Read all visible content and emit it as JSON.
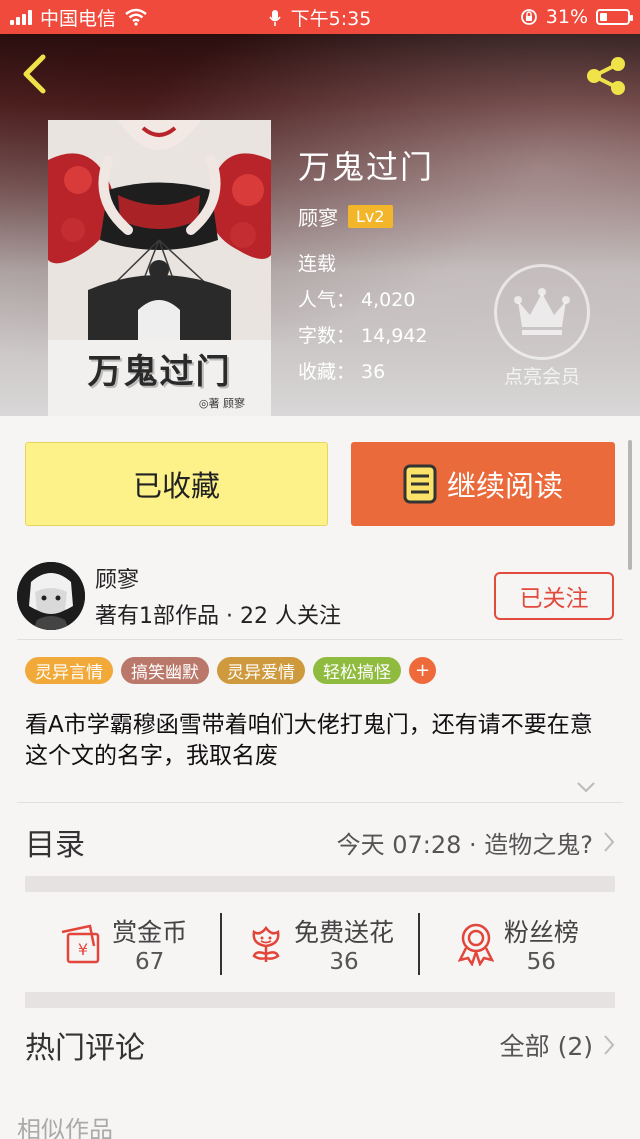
{
  "statusbar": {
    "carrier": "中国电信",
    "time": "下午5:35",
    "battery": "31%",
    "battery_level": 0.31
  },
  "book": {
    "title": "万鬼过门",
    "cover_title": "万鬼过门",
    "cover_author": "◎著 顾寥",
    "author": "顾寥",
    "level": "Lv2",
    "status": "连载",
    "stats": [
      {
        "label": "人气：",
        "value": "4,020"
      },
      {
        "label": "字数：",
        "value": "14,942"
      },
      {
        "label": "收藏：",
        "value": "36"
      }
    ],
    "vip_label": "点亮会员"
  },
  "actions": {
    "favorite_label": "已收藏",
    "read_label": "继续阅读"
  },
  "author_block": {
    "name": "顾寥",
    "meta": "著有1部作品 · 22 人关注",
    "follow_label": "已关注"
  },
  "tags": [
    {
      "label": "灵异言情",
      "color": "#f1a93a"
    },
    {
      "label": "搞笑幽默",
      "color": "#b9786a"
    },
    {
      "label": "灵异爱情",
      "color": "#cf9a3e"
    },
    {
      "label": "轻松搞怪",
      "color": "#8fbb3f"
    }
  ],
  "tag_more": "+",
  "description": "看A市学霸穆函雪带着咱们大佬打鬼门，还有请不要在意这个文的名字，我取名废",
  "toc": {
    "title": "目录",
    "latest": "今天 07:28 · 造物之鬼?"
  },
  "stats_row": [
    {
      "label": "赏金币",
      "value": "67",
      "icon": "coin-envelope-icon"
    },
    {
      "label": "免费送花",
      "value": "36",
      "icon": "flower-icon"
    },
    {
      "label": "粉丝榜",
      "value": "56",
      "icon": "medal-icon"
    }
  ],
  "comments": {
    "title": "热门评论",
    "all_label": "全部 (2)"
  },
  "similar_label": "相似作品",
  "colors": {
    "status_bar": "#ef4a3c",
    "accent_orange": "#ea6a3c",
    "favorite_yellow": "#fdf28a",
    "level_badge": "#f3b52a",
    "follow_red": "#e24a3c"
  }
}
